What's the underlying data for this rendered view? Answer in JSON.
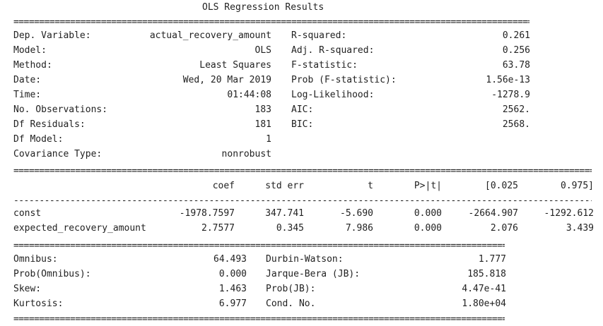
{
  "title": "OLS Regression Results",
  "summary": {
    "left": [
      {
        "label": "Dep. Variable:",
        "value": "actual_recovery_amount"
      },
      {
        "label": "Model:",
        "value": "OLS"
      },
      {
        "label": "Method:",
        "value": "Least Squares"
      },
      {
        "label": "Date:",
        "value": "Wed, 20 Mar 2019"
      },
      {
        "label": "Time:",
        "value": "01:44:08"
      },
      {
        "label": "No. Observations:",
        "value": "183"
      },
      {
        "label": "Df Residuals:",
        "value": "181"
      },
      {
        "label": "Df Model:",
        "value": "1"
      },
      {
        "label": "Covariance Type:",
        "value": "nonrobust"
      }
    ],
    "right": [
      {
        "label": "R-squared:",
        "value": "0.261"
      },
      {
        "label": "Adj. R-squared:",
        "value": "0.256"
      },
      {
        "label": "F-statistic:",
        "value": "63.78"
      },
      {
        "label": "Prob (F-statistic):",
        "value": "1.56e-13"
      },
      {
        "label": "Log-Likelihood:",
        "value": "-1278.9"
      },
      {
        "label": "AIC:",
        "value": "2562."
      },
      {
        "label": "BIC:",
        "value": "2568."
      }
    ]
  },
  "coef_table": {
    "headers": [
      "coef",
      "std err",
      "t",
      "P>|t|",
      "[0.025",
      "0.975]"
    ],
    "rows": [
      {
        "name": "const",
        "values": [
          "-1978.7597",
          "347.741",
          "-5.690",
          "0.000",
          "-2664.907",
          "-1292.612"
        ]
      },
      {
        "name": "expected_recovery_amount",
        "values": [
          "2.7577",
          "0.345",
          "7.986",
          "0.000",
          "2.076",
          "3.439"
        ]
      }
    ]
  },
  "diagnostics": {
    "left": [
      {
        "label": "Omnibus:",
        "value": "64.493"
      },
      {
        "label": "Prob(Omnibus):",
        "value": "0.000"
      },
      {
        "label": "Skew:",
        "value": "1.463"
      },
      {
        "label": "Kurtosis:",
        "value": "6.977"
      }
    ],
    "right": [
      {
        "label": "Durbin-Watson:",
        "value": "1.777"
      },
      {
        "label": "Jarque-Bera (JB):",
        "value": "185.818"
      },
      {
        "label": "Prob(JB):",
        "value": "4.47e-41"
      },
      {
        "label": "Cond. No.",
        "value": "1.80e+04"
      }
    ]
  }
}
